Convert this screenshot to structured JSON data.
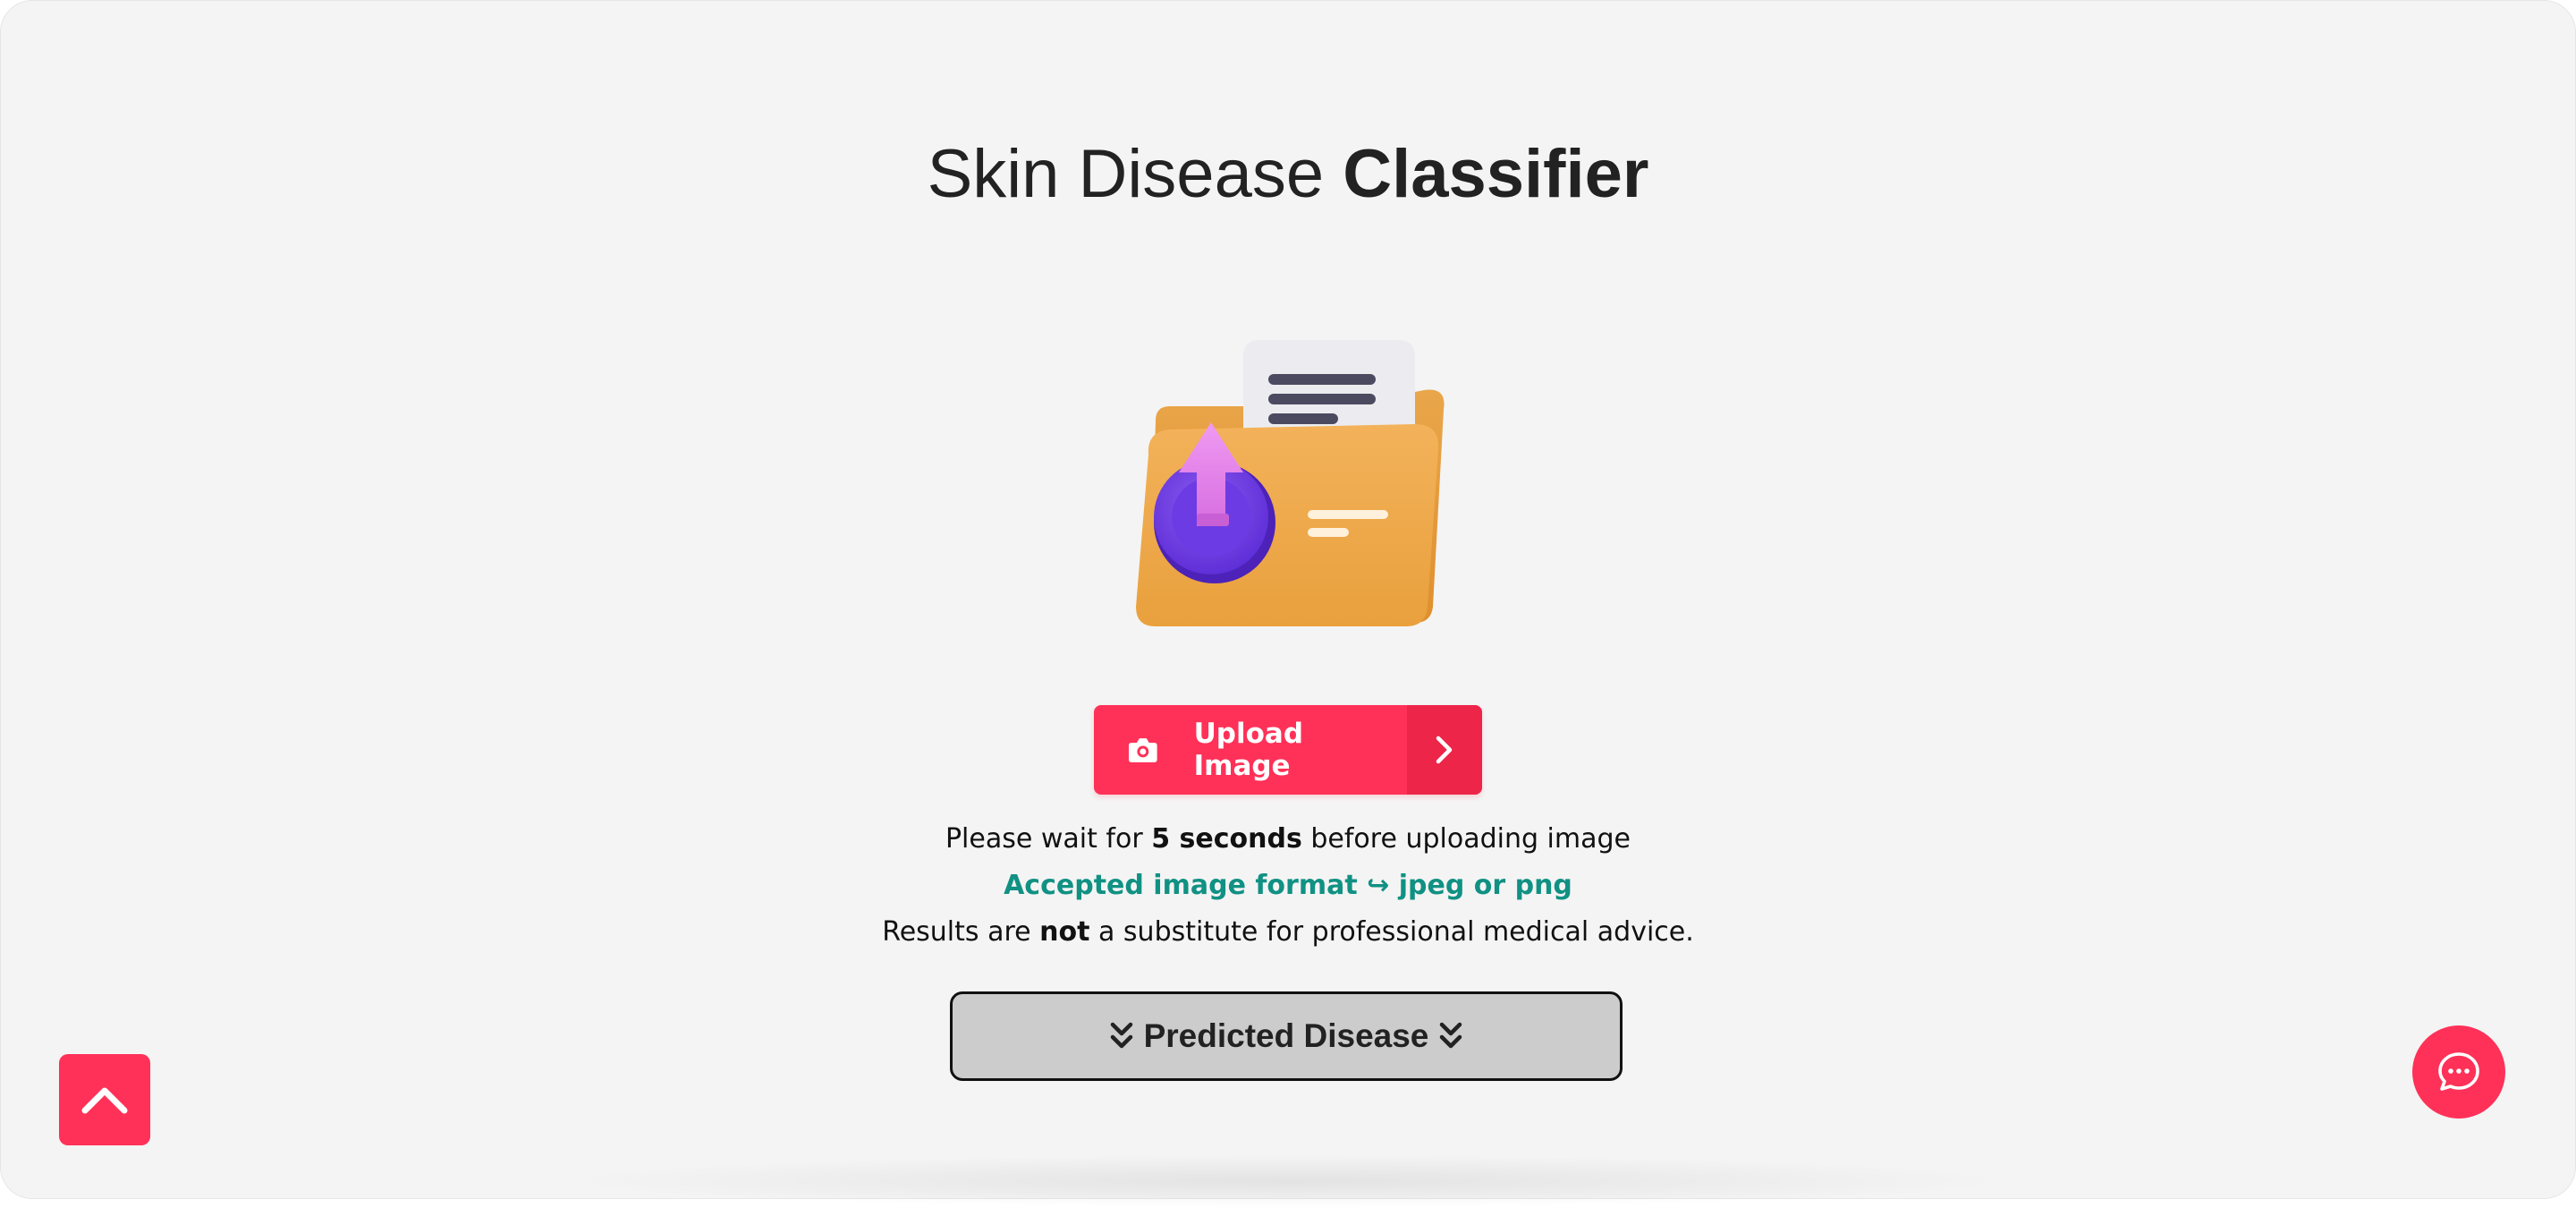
{
  "page": {
    "title_regular": "Skin Disease",
    "title_bold": "Classifier"
  },
  "illustration": {
    "icon": "folder-upload-illustration-icon"
  },
  "upload": {
    "label": "Upload Image",
    "icon": "camera-icon",
    "arrow_icon": "chevron-right-icon"
  },
  "notes": {
    "wait_prefix": "Please wait for",
    "wait_bold": "5 seconds",
    "wait_suffix": "before uploading image",
    "format_prefix": "Accepted image format",
    "format_arrow": "↪",
    "format_suffix": "jpeg or png",
    "disclaimer_prefix": "Results are",
    "disclaimer_bold": "not",
    "disclaimer_suffix": "a substitute for professional medical advice."
  },
  "predicted": {
    "label": "Predicted Disease",
    "icon": "double-chevron-down-icon"
  },
  "scroll_top": {
    "icon": "chevron-up-icon"
  },
  "chat": {
    "icon": "chat-bubble-icon"
  },
  "colors": {
    "accent": "#ff3158",
    "accent_dark": "#ec2549",
    "format_text": "#109183",
    "predicted_bg": "#cccccc",
    "background": "#f4f4f4"
  }
}
